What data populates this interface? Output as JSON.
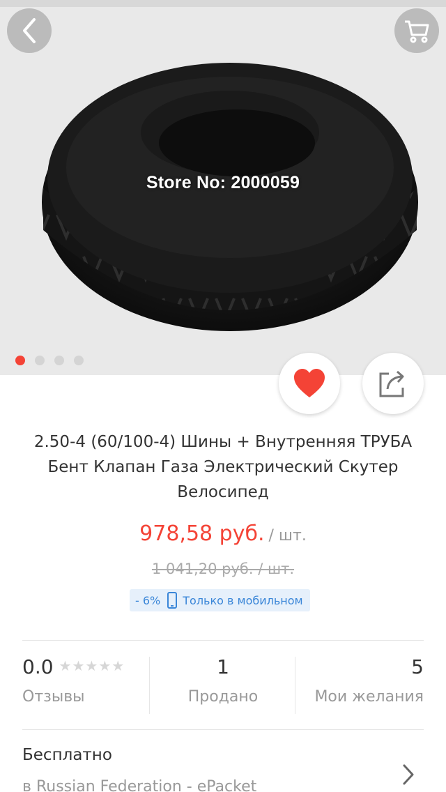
{
  "product_image": {
    "watermark": "Store No: 2000059",
    "carousel": {
      "count": 4,
      "active_index": 0
    }
  },
  "icons": {
    "back": "chevron-left-icon",
    "cart": "cart-icon",
    "favorite": "heart-icon",
    "share": "share-icon",
    "mobile": "mobile-phone-icon",
    "more": "chevron-right-icon"
  },
  "colors": {
    "accent_red": "#f44336",
    "promo_blue": "#3a86d8",
    "promo_bg": "#e6f0fb"
  },
  "product": {
    "title": "2.50-4 (60/100-4) Шины + Внутренняя ТРУБА Бент Клапан Газа Электрический Скутер Велосипед",
    "price": "978,58 руб.",
    "price_unit": "/ шт.",
    "old_price": "1 041,20 руб.  / шт.",
    "discount": "- 6%",
    "mobile_only": "Только в мобильном"
  },
  "stats": {
    "rating": "0.0",
    "rating_stars": 5,
    "reviews_label": "Отзывы",
    "sold_count": "1",
    "sold_label": "Продано",
    "wishlist_count": "5",
    "wishlist_label": "Мои желания"
  },
  "shipping": {
    "title": "Бесплатно",
    "subtitle": "в Russian Federation - ePacket"
  }
}
